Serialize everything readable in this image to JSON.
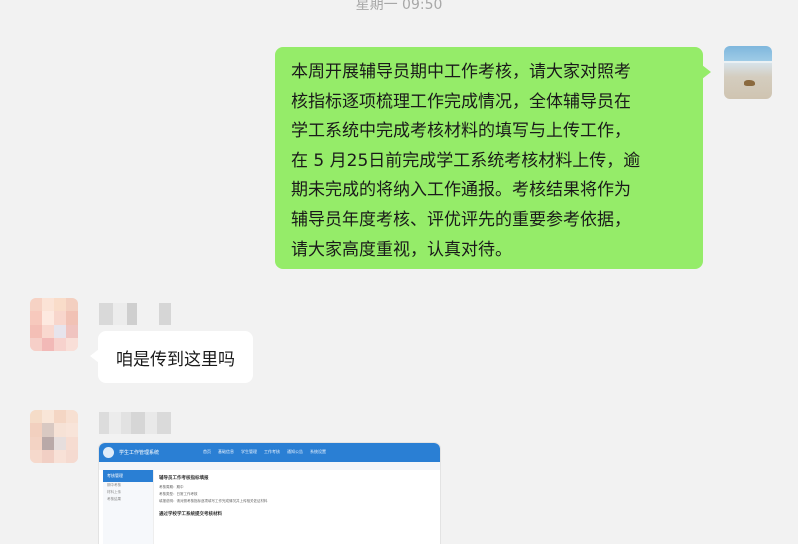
{
  "header": {
    "timestamp": "星期一 09:50"
  },
  "messages": {
    "outgoing": {
      "lines": [
        "本周开展辅导员期中工作考核，请大家对照考",
        "核指标逐项梳理工作完成情况，全体辅导员在",
        "学工系统中完成考核材料的填写与上传工作，",
        "在 5 月25日前完成学工系统考核材料上传，逾",
        "期未完成的将纳入工作通报。考核结果将作为",
        "辅导员年度考核、评优评先的重要参考依据，",
        "请大家高度重视，认真对待。"
      ]
    },
    "incoming_text": "咱是传到这里吗",
    "incoming_image": {
      "site_name": "学生工作管理系统",
      "nav": [
        "首页",
        "基础信息",
        "学生管理",
        "工作考核",
        "通知公告",
        "系统设置"
      ],
      "sidebar_title": "考核管理",
      "sidebar_items": [
        "期中考核",
        "材料上传",
        "考核结果"
      ],
      "title": "辅导员工作考核指标填报",
      "lines": [
        "考核周期：期中",
        "考核类型：日常工作考核",
        "填报说明：请对照考核指标逐项填写工作完成情况并上传相关佐证材料"
      ],
      "subtitle": "通过学校学工系统提交考核材料"
    }
  },
  "colors": {
    "background": "#f2f2f2",
    "outgoing_bubble": "#95ec69",
    "incoming_bubble": "#ffffff",
    "system_header": "#2a7fd4"
  }
}
